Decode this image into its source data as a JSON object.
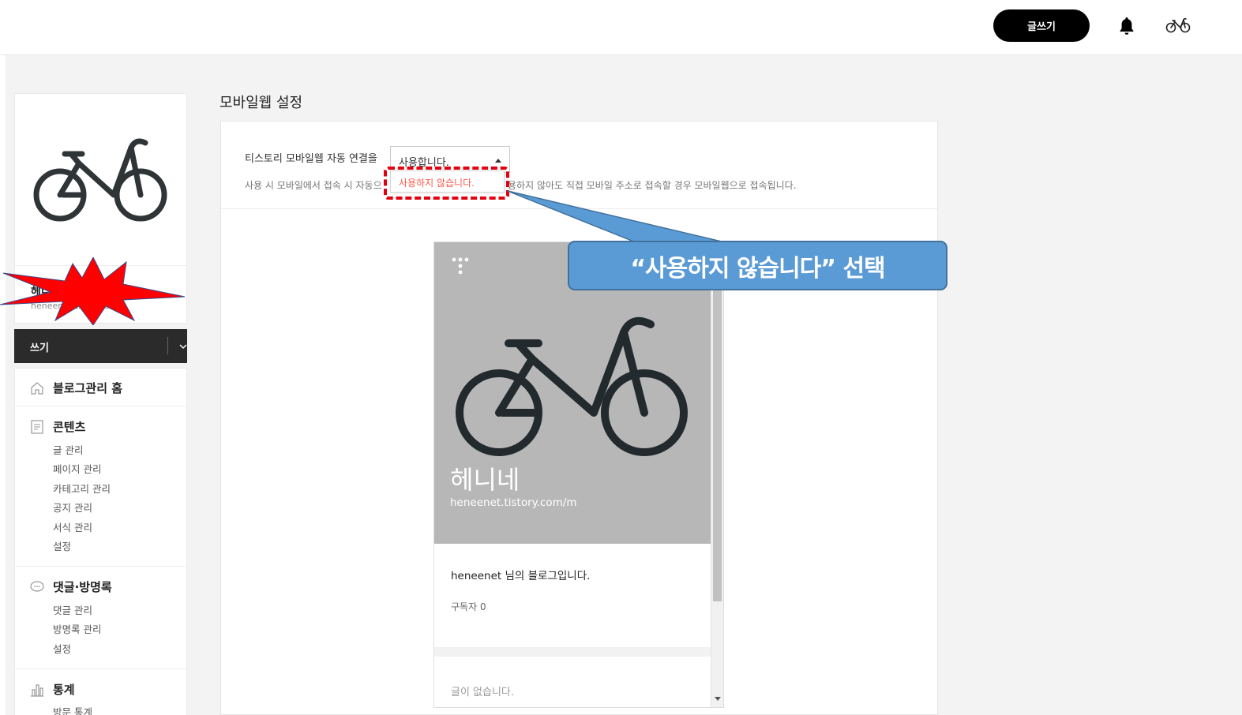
{
  "topbar": {
    "write_label": "글쓰기",
    "icons": [
      "bell-icon",
      "bicycle-avatar-icon"
    ]
  },
  "sidebar": {
    "profile": {
      "name": "헤니네",
      "url": "heneenet.tistory.com"
    },
    "write_label": "쓰기",
    "home_label": "블로그관리 홈",
    "sections": [
      {
        "label": "콘텐츠",
        "items": [
          "글 관리",
          "페이지 관리",
          "카테고리 관리",
          "공지 관리",
          "서식 관리",
          "설정"
        ]
      },
      {
        "label": "댓글·방명록",
        "items": [
          "댓글 관리",
          "방명록 관리",
          "설정"
        ]
      },
      {
        "label": "통계",
        "items": [
          "방문 통계"
        ]
      }
    ]
  },
  "main": {
    "title": "모바일웹 설정",
    "setting": {
      "label": "티스토리 모바일웹 자동 연결을",
      "selected": "사용합니다.",
      "dropdown_option": "사용하지 않습니다.",
      "desc_left": "사용 시 모바일에서 접속 시 자동으",
      "desc_right": "용하지 않아도 직접 모바일 주소로 접속할 경우 모바일웹으로 접속됩니다."
    },
    "preview": {
      "blog_title": "헤니네",
      "blog_url": "heneenet.tistory.com/m",
      "description": "heneenet 님의 블로그입니다.",
      "subscribers_label": "구독자",
      "subscribers_count": "0",
      "empty_message": "글이 없습니다."
    }
  },
  "annotation": {
    "callout": "“사용하지 않습니다” 선택",
    "callout_color": "#5b9bd5",
    "highlight_color": "#e3000f",
    "burst_color": "#ff0000"
  }
}
